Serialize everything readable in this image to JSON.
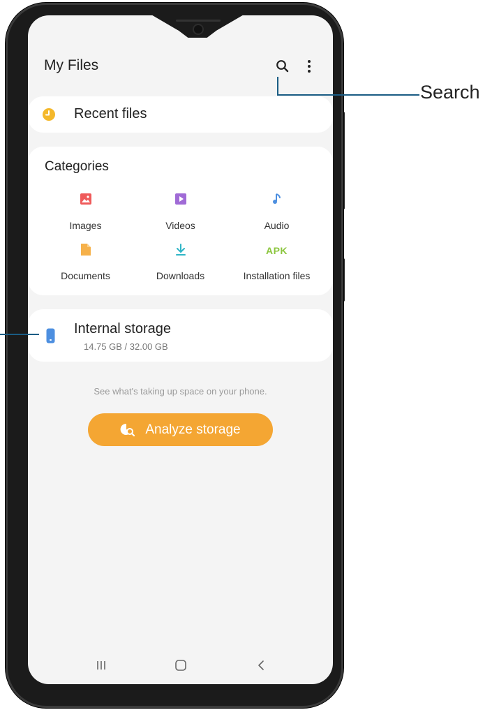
{
  "app": {
    "title": "My Files"
  },
  "toolbar": {
    "search_icon": "search-icon",
    "more_icon": "more-options-icon"
  },
  "recent": {
    "label": "Recent files",
    "icon": "clock-icon",
    "icon_color": "#f4b82b"
  },
  "categories": {
    "title": "Categories",
    "items": [
      {
        "label": "Images",
        "icon": "image-icon",
        "color": "#ef5a5a"
      },
      {
        "label": "Videos",
        "icon": "video-icon",
        "color": "#a06bd6"
      },
      {
        "label": "Audio",
        "icon": "music-note-icon",
        "color": "#4d8fe0"
      },
      {
        "label": "Documents",
        "icon": "document-icon",
        "color": "#f6b14a"
      },
      {
        "label": "Downloads",
        "icon": "download-icon",
        "color": "#2fb5c6"
      },
      {
        "label": "Installation files",
        "icon": "apk-icon",
        "icon_text": "APK",
        "color": "#8cc63f"
      }
    ]
  },
  "storage": {
    "label": "Internal storage",
    "usage": "14.75 GB / 32.00 GB",
    "icon_color": "#4d8fe0"
  },
  "hint": "See what's taking up space on your phone.",
  "analyze": {
    "label": "Analyze storage",
    "color": "#f4a633"
  },
  "callouts": {
    "search": "Search"
  },
  "colors": {
    "callout_line": "#1a5c84",
    "screen_bg": "#f4f4f4",
    "frame": "#1b1b1b"
  }
}
